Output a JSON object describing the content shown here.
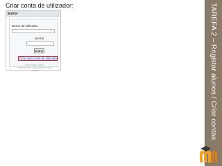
{
  "slide": {
    "caption": "Criar conta de utilizador:",
    "vertical_title": "TAREFA 2 – Registar alunos / Criar contas"
  },
  "login_box": {
    "header": "Entrar",
    "username_label": "Nome de utilizador",
    "password_label": "Senha",
    "login_button": "Entrar",
    "create_account_link": "Criar uma conta de utilizador",
    "faint_lines": [
      "Entrar sem conta",
      "Pode ter sido criada para si uma conta"
    ]
  },
  "colors": {
    "sidebar": "#8a7a68",
    "highlight_border": "#d0202a",
    "link": "#1c3fb0"
  },
  "icons": [
    "moodle-logo-icon",
    "graduation-cap-icon"
  ]
}
